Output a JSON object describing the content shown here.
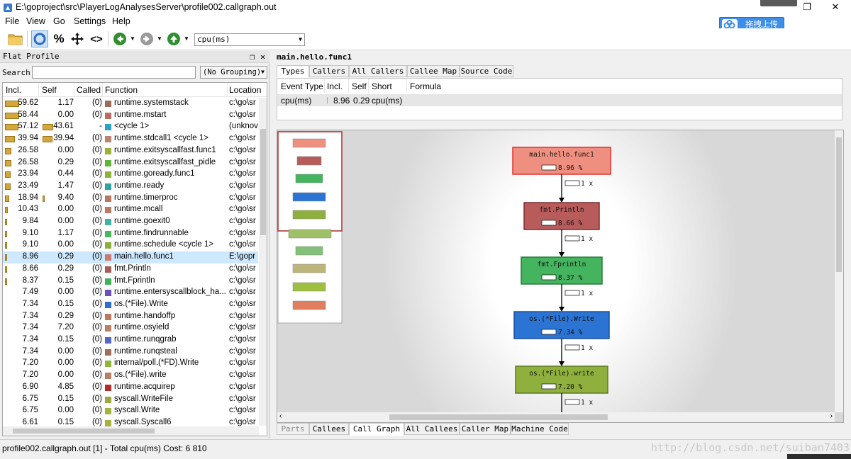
{
  "window": {
    "title": "E:\\goproject\\src\\PlayerLogAnalysesServer\\profile002.callgraph.out",
    "restore_glyph": "❐",
    "close_glyph": "✕"
  },
  "menu": [
    "File",
    "View",
    "Go",
    "Settings",
    "Help"
  ],
  "toolbar": {
    "percent_label": "%",
    "cycle_label": "<>",
    "event_type": "cpu(ms)",
    "dropdown_arrow": "▼"
  },
  "upload_widget": {
    "label": "拖拽上传"
  },
  "flat_profile": {
    "title": "Flat Profile",
    "float_glyph": "❐",
    "close_glyph": "✕",
    "search_label": "Search:",
    "search_value": "",
    "grouping": "(No Grouping)",
    "columns": [
      "Incl.",
      "Self",
      "Called",
      "Function",
      "Location"
    ],
    "rows": [
      {
        "incl": "59.62",
        "self": "1.17",
        "called": "(0)",
        "fn": "runtime.systemstack",
        "loc": "c:\\go\\sr",
        "color": "#9c6b57",
        "incl_frac": 0.596,
        "self_frac": 0
      },
      {
        "incl": "58.44",
        "self": "0.00",
        "called": "(0)",
        "fn": "runtime.mstart",
        "loc": "c:\\go\\sr",
        "color": "#b86d5e",
        "incl_frac": 0.584,
        "self_frac": 0
      },
      {
        "incl": "57.12",
        "self": "43.61",
        "called": "-",
        "fn": "<cycle 1>",
        "loc": "(unknov",
        "color": "#29a3c7",
        "incl_frac": 0.571,
        "self_frac": 0.436
      },
      {
        "incl": "39.94",
        "self": "39.94",
        "called": "(0)",
        "fn": "runtime.stdcall1 <cycle 1>",
        "loc": "c:\\go\\sr",
        "color": "#b9836e",
        "incl_frac": 0.399,
        "self_frac": 0.399
      },
      {
        "incl": "26.58",
        "self": "0.00",
        "called": "(0)",
        "fn": "runtime.exitsyscallfast.func1",
        "loc": "c:\\go\\sr",
        "color": "#9cb13a",
        "incl_frac": 0.266,
        "self_frac": 0
      },
      {
        "incl": "26.58",
        "self": "0.29",
        "called": "(0)",
        "fn": "runtime.exitsyscallfast_pidle",
        "loc": "c:\\go\\sr",
        "color": "#5db63a",
        "incl_frac": 0.266,
        "self_frac": 0
      },
      {
        "incl": "23.94",
        "self": "0.44",
        "called": "(0)",
        "fn": "runtime.goready.func1",
        "loc": "c:\\go\\sr",
        "color": "#8fb338",
        "incl_frac": 0.239,
        "self_frac": 0
      },
      {
        "incl": "23.49",
        "self": "1.47",
        "called": "(0)",
        "fn": "runtime.ready",
        "loc": "c:\\go\\sr",
        "color": "#2ea3a0",
        "incl_frac": 0.235,
        "self_frac": 0
      },
      {
        "incl": "18.94",
        "self": "9.40",
        "called": "(0)",
        "fn": "runtime.timerproc",
        "loc": "c:\\go\\sr",
        "color": "#b77a60",
        "incl_frac": 0.189,
        "self_frac": 0.094
      },
      {
        "incl": "10.43",
        "self": "0.00",
        "called": "(0)",
        "fn": "runtime.mcall",
        "loc": "c:\\go\\sr",
        "color": "#b87a62",
        "incl_frac": 0.104,
        "self_frac": 0
      },
      {
        "incl": "9.84",
        "self": "0.00",
        "called": "(0)",
        "fn": "runtime.goexit0",
        "loc": "c:\\go\\sr",
        "color": "#3fb3a3",
        "incl_frac": 0.098,
        "self_frac": 0
      },
      {
        "incl": "9.10",
        "self": "1.17",
        "called": "(0)",
        "fn": "runtime.findrunnable",
        "loc": "c:\\go\\sr",
        "color": "#4ab65a",
        "incl_frac": 0.091,
        "self_frac": 0
      },
      {
        "incl": "9.10",
        "self": "0.00",
        "called": "(0)",
        "fn": "runtime.schedule <cycle 1>",
        "loc": "c:\\go\\sr",
        "color": "#8ab03b",
        "incl_frac": 0.091,
        "self_frac": 0
      },
      {
        "incl": "8.96",
        "self": "0.29",
        "called": "(0)",
        "fn": "main.hello.func1",
        "loc": "E:\\gopr",
        "color": "#c97a6c",
        "incl_frac": 0.09,
        "self_frac": 0,
        "selected": true
      },
      {
        "incl": "8.66",
        "self": "0.29",
        "called": "(0)",
        "fn": "fmt.Println",
        "loc": "c:\\go\\sr",
        "color": "#a55c58",
        "incl_frac": 0.087,
        "self_frac": 0
      },
      {
        "incl": "8.37",
        "self": "0.15",
        "called": "(0)",
        "fn": "fmt.Fprintln",
        "loc": "c:\\go\\sr",
        "color": "#43b35b",
        "incl_frac": 0.084,
        "self_frac": 0
      },
      {
        "incl": "7.49",
        "self": "0.00",
        "called": "(0)",
        "fn": "runtime.entersyscallblock_ha...",
        "loc": "c:\\go\\sr",
        "color": "#6a4fc1",
        "incl_frac": 0,
        "self_frac": 0
      },
      {
        "incl": "7.34",
        "self": "0.15",
        "called": "(0)",
        "fn": "os.(*File).Write",
        "loc": "c:\\go\\sr",
        "color": "#2d6fd0",
        "incl_frac": 0,
        "self_frac": 0
      },
      {
        "incl": "7.34",
        "self": "0.29",
        "called": "(0)",
        "fn": "runtime.handoffp",
        "loc": "c:\\go\\sr",
        "color": "#bb7a62",
        "incl_frac": 0,
        "self_frac": 0
      },
      {
        "incl": "7.34",
        "self": "7.20",
        "called": "(0)",
        "fn": "runtime.osyield",
        "loc": "c:\\go\\sr",
        "color": "#b88362",
        "incl_frac": 0,
        "self_frac": 0
      },
      {
        "incl": "7.34",
        "self": "0.15",
        "called": "(0)",
        "fn": "runtime.runqgrab",
        "loc": "c:\\go\\sr",
        "color": "#5567c4",
        "incl_frac": 0,
        "self_frac": 0
      },
      {
        "incl": "7.34",
        "self": "0.00",
        "called": "(0)",
        "fn": "runtime.runqsteal",
        "loc": "c:\\go\\sr",
        "color": "#a06c5a",
        "incl_frac": 0,
        "self_frac": 0
      },
      {
        "incl": "7.20",
        "self": "0.00",
        "called": "(0)",
        "fn": "internal/poll.(*FD).Write",
        "loc": "c:\\go\\sr",
        "color": "#8fb53a",
        "incl_frac": 0,
        "self_frac": 0
      },
      {
        "incl": "7.20",
        "self": "0.00",
        "called": "(0)",
        "fn": "os.(*File).write",
        "loc": "c:\\go\\sr",
        "color": "#b48066",
        "incl_frac": 0,
        "self_frac": 0
      },
      {
        "incl": "6.90",
        "self": "4.85",
        "called": "(0)",
        "fn": "runtime.acquirep",
        "loc": "c:\\go\\sr",
        "color": "#b52a2a",
        "incl_frac": 0,
        "self_frac": 0
      },
      {
        "incl": "6.75",
        "self": "0.15",
        "called": "(0)",
        "fn": "syscall.WriteFile",
        "loc": "c:\\go\\sr",
        "color": "#9aa93a",
        "incl_frac": 0,
        "self_frac": 0
      },
      {
        "incl": "6.75",
        "self": "0.00",
        "called": "(0)",
        "fn": "syscall.Write",
        "loc": "c:\\go\\sr",
        "color": "#a4b33c",
        "incl_frac": 0,
        "self_frac": 0
      },
      {
        "incl": "6.61",
        "self": "0.15",
        "called": "(0)",
        "fn": "syscall.Syscall6",
        "loc": "c:\\go\\sr",
        "color": "#a9b23c",
        "incl_frac": 0,
        "self_frac": 0
      }
    ]
  },
  "detail": {
    "function_title": "main.hello.func1",
    "top_tabs": [
      "Types",
      "Callers",
      "All Callers",
      "Callee Map",
      "Source Code"
    ],
    "types_table": {
      "columns": [
        "Event Type",
        "Incl.",
        "Self",
        "Short",
        "Formula"
      ],
      "row": {
        "event": "cpu(ms)",
        "incl": "8.96",
        "self": "0.29",
        "short": "cpu(ms)",
        "formula": ""
      }
    },
    "bottom_tabs": [
      "Parts",
      "Callees",
      "Call Graph",
      "All Callees",
      "Caller Map",
      "Machine Code"
    ]
  },
  "call_graph": {
    "nodes": [
      {
        "name": "main.hello.func1",
        "cost": "8.96 %",
        "fill": "#ef8f7f",
        "stroke": "#e03030"
      },
      {
        "name": "fmt.Println",
        "cost": "8.66 %",
        "fill": "#b85b5b",
        "stroke": "#7a3030"
      },
      {
        "name": "fmt.Fprintln",
        "cost": "8.37 %",
        "fill": "#45b45f",
        "stroke": "#2b7a3c"
      },
      {
        "name": "os.(*File).Write",
        "cost": "7.34 %",
        "fill": "#2b74d4",
        "stroke": "#1b4f99"
      },
      {
        "name": "os.(*File).write",
        "cost": "7.20 %",
        "fill": "#8fb03c",
        "stroke": "#5f7a22"
      }
    ],
    "edge_label": "1 x",
    "overview_colors": [
      "#ef8f7f",
      "#b85b5b",
      "#45b45f",
      "#2b74d4",
      "#8fb03c",
      "#9fc067",
      "#83c078",
      "#bdb67a",
      "#9fbf3f",
      "#e07f5f"
    ]
  },
  "status": {
    "text": "profile002.callgraph.out [1] - Total cpu(ms) Cost: 6 810",
    "watermark": "http://blog.csdn.net/suiban7403"
  }
}
